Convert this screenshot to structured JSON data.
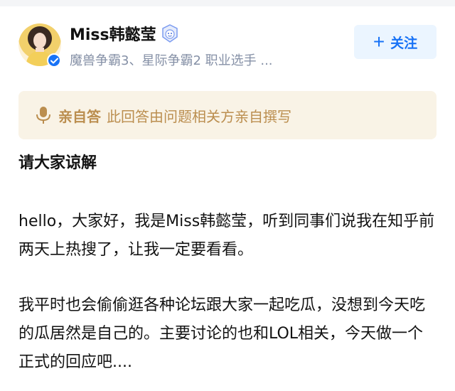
{
  "author": {
    "name": "Miss韩懿莹",
    "description": "魔兽争霸3、星际争霸2 职业选手 ...",
    "badge_icon": "badge-icon",
    "verified_icon": "verified-check-icon"
  },
  "follow_button": {
    "label": "关注",
    "icon": "plus-icon"
  },
  "notice": {
    "icon": "mic-icon",
    "strong": "亲自答",
    "text": "此回答由问题相关方亲自撰写"
  },
  "content": {
    "heading": "请大家谅解",
    "paragraphs": [
      "hello，大家好，我是Miss韩懿莹，听到同事们说我在知乎前两天上热搜了，让我一定要看看。",
      "我平时也会偷偷逛各种论坛跟大家一起吃瓜，没想到今天吃的瓜居然是自己的。主要讨论的也和LOL相关，今天做一个正式的回应吧...."
    ]
  },
  "colors": {
    "accent": "#1772f6",
    "notice_bg": "#f9f3e6",
    "notice_text": "#bb8e4f",
    "muted": "#8590a6"
  }
}
